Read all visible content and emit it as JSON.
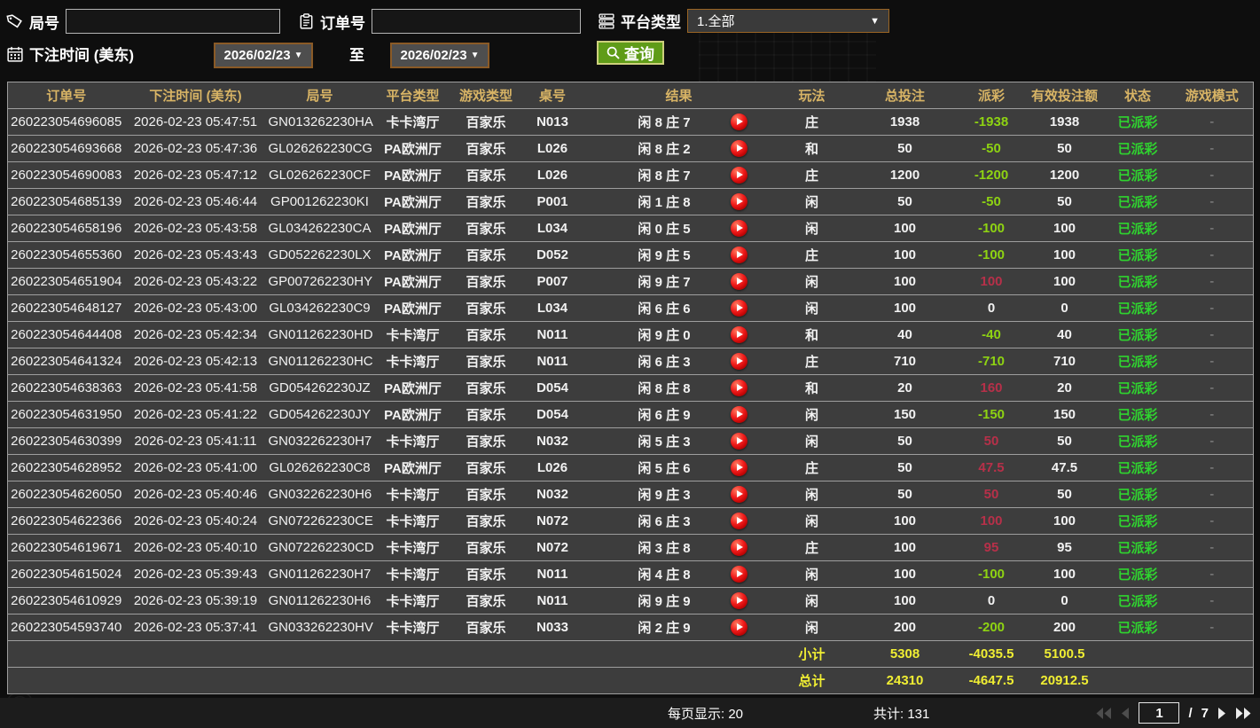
{
  "filters": {
    "round_label": "局号",
    "round_value": "",
    "order_label": "订单号",
    "order_value": "",
    "platform_label": "平台类型",
    "platform_value": "1.全部",
    "bet_time_label": "下注时间 (美东)",
    "date_from": "2026/02/23",
    "to_label": "至",
    "date_to": "2026/02/23",
    "search_label": "查询"
  },
  "icons": {
    "round": "tag-icon",
    "order": "clipboard-icon",
    "platform": "server-icon",
    "bet_time": "calendar-icon",
    "search": "magnifier-icon",
    "result_row": "play-icon",
    "pager": [
      "first-page-icon",
      "prev-page-icon",
      "next-page-icon",
      "last-page-icon"
    ]
  },
  "table": {
    "columns": [
      "订单号",
      "下注时间 (美东)",
      "局号",
      "平台类型",
      "游戏类型",
      "桌号",
      "结果",
      "玩法",
      "总投注",
      "派彩",
      "有效投注额",
      "状态",
      "游戏模式"
    ],
    "rows": [
      {
        "order_no": "260223054696085",
        "bet_time": "2026-02-23 05:47:51",
        "round_no": "GN013262230HA",
        "platform": "卡卡湾厅",
        "game_type": "百家乐",
        "table_no": "N013",
        "result": "闲 8 庄 7",
        "play": "庄",
        "total_bet": "1938",
        "payout": "-1938",
        "payout_class": "neg",
        "valid_bet": "1938",
        "status": "已派彩",
        "mode": "-"
      },
      {
        "order_no": "260223054693668",
        "bet_time": "2026-02-23 05:47:36",
        "round_no": "GL026262230CG",
        "platform": "PA欧洲厅",
        "game_type": "百家乐",
        "table_no": "L026",
        "result": "闲 8 庄 2",
        "play": "和",
        "total_bet": "50",
        "payout": "-50",
        "payout_class": "neg",
        "valid_bet": "50",
        "status": "已派彩",
        "mode": "-"
      },
      {
        "order_no": "260223054690083",
        "bet_time": "2026-02-23 05:47:12",
        "round_no": "GL026262230CF",
        "platform": "PA欧洲厅",
        "game_type": "百家乐",
        "table_no": "L026",
        "result": "闲 8 庄 7",
        "play": "庄",
        "total_bet": "1200",
        "payout": "-1200",
        "payout_class": "neg",
        "valid_bet": "1200",
        "status": "已派彩",
        "mode": "-"
      },
      {
        "order_no": "260223054685139",
        "bet_time": "2026-02-23 05:46:44",
        "round_no": "GP001262230KI",
        "platform": "PA欧洲厅",
        "game_type": "百家乐",
        "table_no": "P001",
        "result": "闲 1 庄 8",
        "play": "闲",
        "total_bet": "50",
        "payout": "-50",
        "payout_class": "neg",
        "valid_bet": "50",
        "status": "已派彩",
        "mode": "-"
      },
      {
        "order_no": "260223054658196",
        "bet_time": "2026-02-23 05:43:58",
        "round_no": "GL034262230CA",
        "platform": "PA欧洲厅",
        "game_type": "百家乐",
        "table_no": "L034",
        "result": "闲 0 庄 5",
        "play": "闲",
        "total_bet": "100",
        "payout": "-100",
        "payout_class": "neg",
        "valid_bet": "100",
        "status": "已派彩",
        "mode": "-"
      },
      {
        "order_no": "260223054655360",
        "bet_time": "2026-02-23 05:43:43",
        "round_no": "GD052262230LX",
        "platform": "PA欧洲厅",
        "game_type": "百家乐",
        "table_no": "D052",
        "result": "闲 9 庄 5",
        "play": "庄",
        "total_bet": "100",
        "payout": "-100",
        "payout_class": "neg",
        "valid_bet": "100",
        "status": "已派彩",
        "mode": "-"
      },
      {
        "order_no": "260223054651904",
        "bet_time": "2026-02-23 05:43:22",
        "round_no": "GP007262230HY",
        "platform": "PA欧洲厅",
        "game_type": "百家乐",
        "table_no": "P007",
        "result": "闲 9 庄 7",
        "play": "闲",
        "total_bet": "100",
        "payout": "100",
        "payout_class": "pos",
        "valid_bet": "100",
        "status": "已派彩",
        "mode": "-"
      },
      {
        "order_no": "260223054648127",
        "bet_time": "2026-02-23 05:43:00",
        "round_no": "GL034262230C9",
        "platform": "PA欧洲厅",
        "game_type": "百家乐",
        "table_no": "L034",
        "result": "闲 6 庄 6",
        "play": "闲",
        "total_bet": "100",
        "payout": "0",
        "payout_class": "zero",
        "valid_bet": "0",
        "status": "已派彩",
        "mode": "-"
      },
      {
        "order_no": "260223054644408",
        "bet_time": "2026-02-23 05:42:34",
        "round_no": "GN011262230HD",
        "platform": "卡卡湾厅",
        "game_type": "百家乐",
        "table_no": "N011",
        "result": "闲 9 庄 0",
        "play": "和",
        "total_bet": "40",
        "payout": "-40",
        "payout_class": "neg",
        "valid_bet": "40",
        "status": "已派彩",
        "mode": "-"
      },
      {
        "order_no": "260223054641324",
        "bet_time": "2026-02-23 05:42:13",
        "round_no": "GN011262230HC",
        "platform": "卡卡湾厅",
        "game_type": "百家乐",
        "table_no": "N011",
        "result": "闲 6 庄 3",
        "play": "庄",
        "total_bet": "710",
        "payout": "-710",
        "payout_class": "neg",
        "valid_bet": "710",
        "status": "已派彩",
        "mode": "-"
      },
      {
        "order_no": "260223054638363",
        "bet_time": "2026-02-23 05:41:58",
        "round_no": "GD054262230JZ",
        "platform": "PA欧洲厅",
        "game_type": "百家乐",
        "table_no": "D054",
        "result": "闲 8 庄 8",
        "play": "和",
        "total_bet": "20",
        "payout": "160",
        "payout_class": "pos",
        "valid_bet": "20",
        "status": "已派彩",
        "mode": "-"
      },
      {
        "order_no": "260223054631950",
        "bet_time": "2026-02-23 05:41:22",
        "round_no": "GD054262230JY",
        "platform": "PA欧洲厅",
        "game_type": "百家乐",
        "table_no": "D054",
        "result": "闲 6 庄 9",
        "play": "闲",
        "total_bet": "150",
        "payout": "-150",
        "payout_class": "neg",
        "valid_bet": "150",
        "status": "已派彩",
        "mode": "-"
      },
      {
        "order_no": "260223054630399",
        "bet_time": "2026-02-23 05:41:11",
        "round_no": "GN032262230H7",
        "platform": "卡卡湾厅",
        "game_type": "百家乐",
        "table_no": "N032",
        "result": "闲 5 庄 3",
        "play": "闲",
        "total_bet": "50",
        "payout": "50",
        "payout_class": "pos",
        "valid_bet": "50",
        "status": "已派彩",
        "mode": "-"
      },
      {
        "order_no": "260223054628952",
        "bet_time": "2026-02-23 05:41:00",
        "round_no": "GL026262230C8",
        "platform": "PA欧洲厅",
        "game_type": "百家乐",
        "table_no": "L026",
        "result": "闲 5 庄 6",
        "play": "庄",
        "total_bet": "50",
        "payout": "47.5",
        "payout_class": "pos",
        "valid_bet": "47.5",
        "status": "已派彩",
        "mode": "-"
      },
      {
        "order_no": "260223054626050",
        "bet_time": "2026-02-23 05:40:46",
        "round_no": "GN032262230H6",
        "platform": "卡卡湾厅",
        "game_type": "百家乐",
        "table_no": "N032",
        "result": "闲 9 庄 3",
        "play": "闲",
        "total_bet": "50",
        "payout": "50",
        "payout_class": "pos",
        "valid_bet": "50",
        "status": "已派彩",
        "mode": "-"
      },
      {
        "order_no": "260223054622366",
        "bet_time": "2026-02-23 05:40:24",
        "round_no": "GN072262230CE",
        "platform": "卡卡湾厅",
        "game_type": "百家乐",
        "table_no": "N072",
        "result": "闲 6 庄 3",
        "play": "闲",
        "total_bet": "100",
        "payout": "100",
        "payout_class": "pos",
        "valid_bet": "100",
        "status": "已派彩",
        "mode": "-"
      },
      {
        "order_no": "260223054619671",
        "bet_time": "2026-02-23 05:40:10",
        "round_no": "GN072262230CD",
        "platform": "卡卡湾厅",
        "game_type": "百家乐",
        "table_no": "N072",
        "result": "闲 3 庄 8",
        "play": "庄",
        "total_bet": "100",
        "payout": "95",
        "payout_class": "pos",
        "valid_bet": "95",
        "status": "已派彩",
        "mode": "-"
      },
      {
        "order_no": "260223054615024",
        "bet_time": "2026-02-23 05:39:43",
        "round_no": "GN011262230H7",
        "platform": "卡卡湾厅",
        "game_type": "百家乐",
        "table_no": "N011",
        "result": "闲 4 庄 8",
        "play": "闲",
        "total_bet": "100",
        "payout": "-100",
        "payout_class": "neg",
        "valid_bet": "100",
        "status": "已派彩",
        "mode": "-"
      },
      {
        "order_no": "260223054610929",
        "bet_time": "2026-02-23 05:39:19",
        "round_no": "GN011262230H6",
        "platform": "卡卡湾厅",
        "game_type": "百家乐",
        "table_no": "N011",
        "result": "闲 9 庄 9",
        "play": "闲",
        "total_bet": "100",
        "payout": "0",
        "payout_class": "zero",
        "valid_bet": "0",
        "status": "已派彩",
        "mode": "-"
      },
      {
        "order_no": "260223054593740",
        "bet_time": "2026-02-23 05:37:41",
        "round_no": "GN033262230HV",
        "platform": "卡卡湾厅",
        "game_type": "百家乐",
        "table_no": "N033",
        "result": "闲 2 庄 9",
        "play": "闲",
        "total_bet": "200",
        "payout": "-200",
        "payout_class": "neg",
        "valid_bet": "200",
        "status": "已派彩",
        "mode": "-"
      }
    ],
    "subtotal": {
      "label": "小计",
      "total_bet": "5308",
      "payout": "-4035.5",
      "valid_bet": "5100.5"
    },
    "total": {
      "label": "总计",
      "total_bet": "24310",
      "payout": "-4647.5",
      "valid_bet": "20912.5"
    }
  },
  "footer": {
    "page_size_label": "每页显示: 20",
    "total_count_label": "共计: 131",
    "current_page": "1",
    "page_divider": "/",
    "total_pages": "7"
  },
  "colors": {
    "header_gold": "#d8b465",
    "status_green": "#2fd32f",
    "payout_negative_green": "#8ed312",
    "payout_positive_red": "#b73049",
    "summary_yellow": "#f0ee33",
    "button_green": "#5f9c18",
    "select_border_brown": "#8a5a26",
    "row_background": "#3d3d3d"
  }
}
